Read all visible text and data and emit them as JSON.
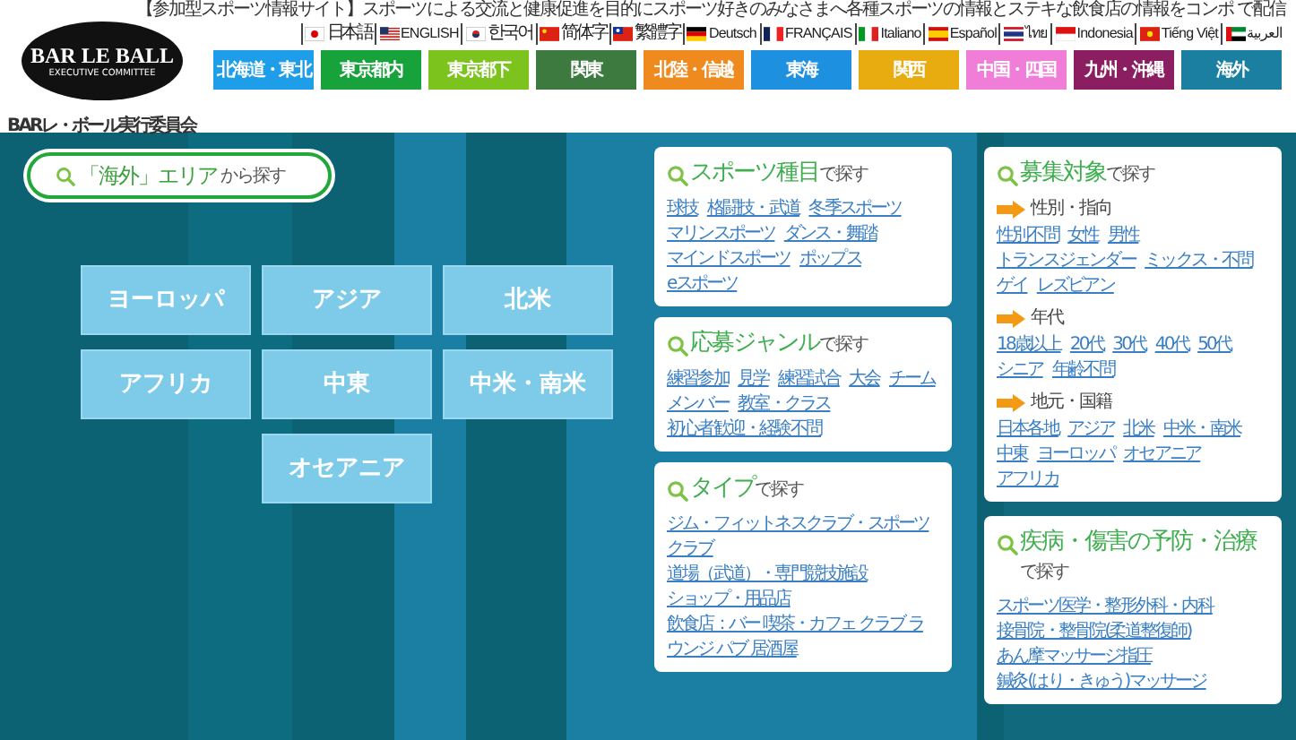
{
  "header": {
    "tagline": "【参加型スポーツ情報サイト】スポーツによる交流と健康促進を目的にスポーツ好きのみなさまへ各種スポーツの情報とステキな飲食店の情報をコンポ で配信",
    "logo": {
      "title": "BAR LE BALL",
      "subtitle": "EXECUTIVE COMMITTEE"
    },
    "org_name": "BARレ・ボール実行委員会",
    "languages": [
      {
        "label": "日本語",
        "kind": "jp"
      },
      {
        "label": "ENGLISH",
        "kind": "us"
      },
      {
        "label": "한국어",
        "kind": "kr"
      },
      {
        "label": "简体字",
        "kind": "cn"
      },
      {
        "label": "繁體字",
        "kind": "tw"
      },
      {
        "label": "Deutsch",
        "kind": "de"
      },
      {
        "label": "FRANÇAIS",
        "kind": "fr"
      },
      {
        "label": "Italiano",
        "kind": "it"
      },
      {
        "label": "Español",
        "kind": "es"
      },
      {
        "label": "ไทย",
        "kind": "th"
      },
      {
        "label": "Indonesia",
        "kind": "id"
      },
      {
        "label": "Tiếng Việt",
        "kind": "vn"
      },
      {
        "label": "العربية",
        "kind": "ae"
      }
    ],
    "regions": [
      {
        "label": "北海道・東北",
        "color": "#1e9ee8"
      },
      {
        "label": "東京都内",
        "color": "#18a23c"
      },
      {
        "label": "東京都下",
        "color": "#7cc31e"
      },
      {
        "label": "関東",
        "color": "#3d7a40"
      },
      {
        "label": "北陸・信越",
        "color": "#ee8a1e"
      },
      {
        "label": "東海",
        "color": "#1e90e0"
      },
      {
        "label": "関西",
        "color": "#e8ab10"
      },
      {
        "label": "中国・四国",
        "color": "#f07ed8"
      },
      {
        "label": "九州・沖縄",
        "color": "#8a1e60"
      },
      {
        "label": "海外",
        "color": "#1a7fa0"
      }
    ]
  },
  "area_search": {
    "highlight": "「海外」エリア",
    "suffix": "から探す"
  },
  "areas": [
    "ヨーロッパ",
    "アジア",
    "北米",
    "アフリカ",
    "中東",
    "中米・南米",
    "オセアニア"
  ],
  "columns": [
    [
      {
        "title": "スポーツ種目",
        "suffix": "で探す",
        "kind": "inline",
        "groups": [
          {
            "links": [
              "球技",
              "格闘技・武道",
              "冬季スポーツ",
              "マリンスポーツ",
              "ダンス・舞踏",
              "マインドスポーツ",
              "ポップス",
              "eスポーツ"
            ]
          }
        ]
      },
      {
        "title": "応募ジャンル",
        "suffix": "で探す",
        "kind": "inline",
        "groups": [
          {
            "links": [
              "練習参加",
              "見学",
              "練習試合",
              "大会",
              "チーム",
              "メンバー",
              "教室・クラス",
              "初心者歓迎・経験不問"
            ]
          }
        ]
      },
      {
        "title": "タイプ",
        "suffix": "で探す",
        "kind": "stacked",
        "groups": [
          {
            "links": [
              "ジム・フィットネスクラブ・スポーツクラブ",
              "道場（武道）・専門競技施設",
              "ショップ・用品店",
              "飲食店：バー 喫茶・カフェ クラブ ラウンジ パブ 居酒屋"
            ]
          }
        ]
      }
    ],
    [
      {
        "title": "募集対象",
        "suffix": "で探す",
        "kind": "inline",
        "groups": [
          {
            "heading": "性別・指向",
            "links": [
              "性別不問",
              "女性",
              "男性",
              "トランスジェンダー",
              "ミックス・不問",
              "ゲイ",
              "レズビアン"
            ]
          },
          {
            "heading": "年代",
            "links": [
              "18歳以上",
              "20代",
              "30代",
              "40代",
              "50代",
              "シニア",
              "年齢不問"
            ]
          },
          {
            "heading": "地元・国籍",
            "links": [
              "日本各地",
              "アジア",
              "北米",
              "中米・南米",
              "中東",
              "ヨーロッパ",
              "オセアニア",
              "アフリカ"
            ]
          }
        ]
      },
      {
        "title": "疾病・傷害の予防・治療",
        "suffix": "で探す",
        "kind": "stacked",
        "groups": [
          {
            "links": [
              "スポーツ医学・整形外科・内科",
              "接骨院・整骨院(柔道整復師)",
              "あん摩マッサージ指圧",
              "鍼灸(はり・きゅう)マッサージ"
            ]
          }
        ]
      }
    ]
  ]
}
